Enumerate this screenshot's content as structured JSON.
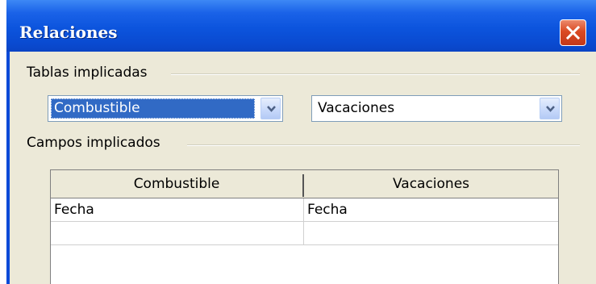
{
  "window": {
    "title": "Relaciones"
  },
  "tablas": {
    "label": "Tablas implicadas",
    "left_selected": "Combustible",
    "right_selected": "Vacaciones"
  },
  "campos": {
    "label": "Campos implicados",
    "columns": [
      "Combustible",
      "Vacaciones"
    ],
    "rows": [
      [
        "Fecha",
        "Fecha"
      ],
      [
        "",
        ""
      ]
    ]
  },
  "icons": {
    "close": "close-icon",
    "dropdown": "chevron-down-icon"
  },
  "colors": {
    "titlebar": "#0a4ad8",
    "close_button": "#db4a22",
    "selection": "#316ac5",
    "dialog_background": "#ece9d8"
  }
}
